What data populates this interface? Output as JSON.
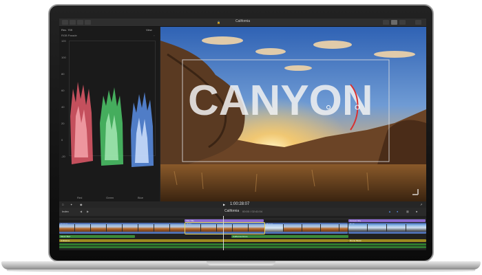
{
  "app": {
    "toolbar_left": "All Clips (16 items)",
    "title": "California",
    "zoom": "67%",
    "view_label": "View"
  },
  "scopes": {
    "format": "Rec. 709",
    "panel": "RGB Parade",
    "view_label": "View",
    "scale": [
      "120",
      "100",
      "80",
      "60",
      "40",
      "20",
      "0",
      "-20"
    ],
    "channels": [
      "Red",
      "Green",
      "Blue"
    ]
  },
  "viewer": {
    "overlay_text": "CANYON",
    "timecode": "1:00:28:07"
  },
  "timeline": {
    "index_label": "Index",
    "project_name": "California",
    "project_time": "00:00 / 02:41:04",
    "clips_top": [
      "Camera",
      "Ranch",
      "Ridge",
      "Rock",
      "Cliffs"
    ],
    "clip_labels": [
      "Canyon",
      "Ridge",
      "Desert",
      "Rock"
    ],
    "connected_labels": [
      "Title Title",
      "Canyon Sky"
    ],
    "audio_labels": [
      "Music Bed",
      "California Drone",
      "Ambience",
      "Drone Music"
    ]
  },
  "colors": {
    "video_clip": "#4f6fb0",
    "connected": "#8b6ad0",
    "audio_green": "#3a8c3a",
    "audio_yellow": "#9c8a1f",
    "playhead": "#d9d9d9"
  }
}
